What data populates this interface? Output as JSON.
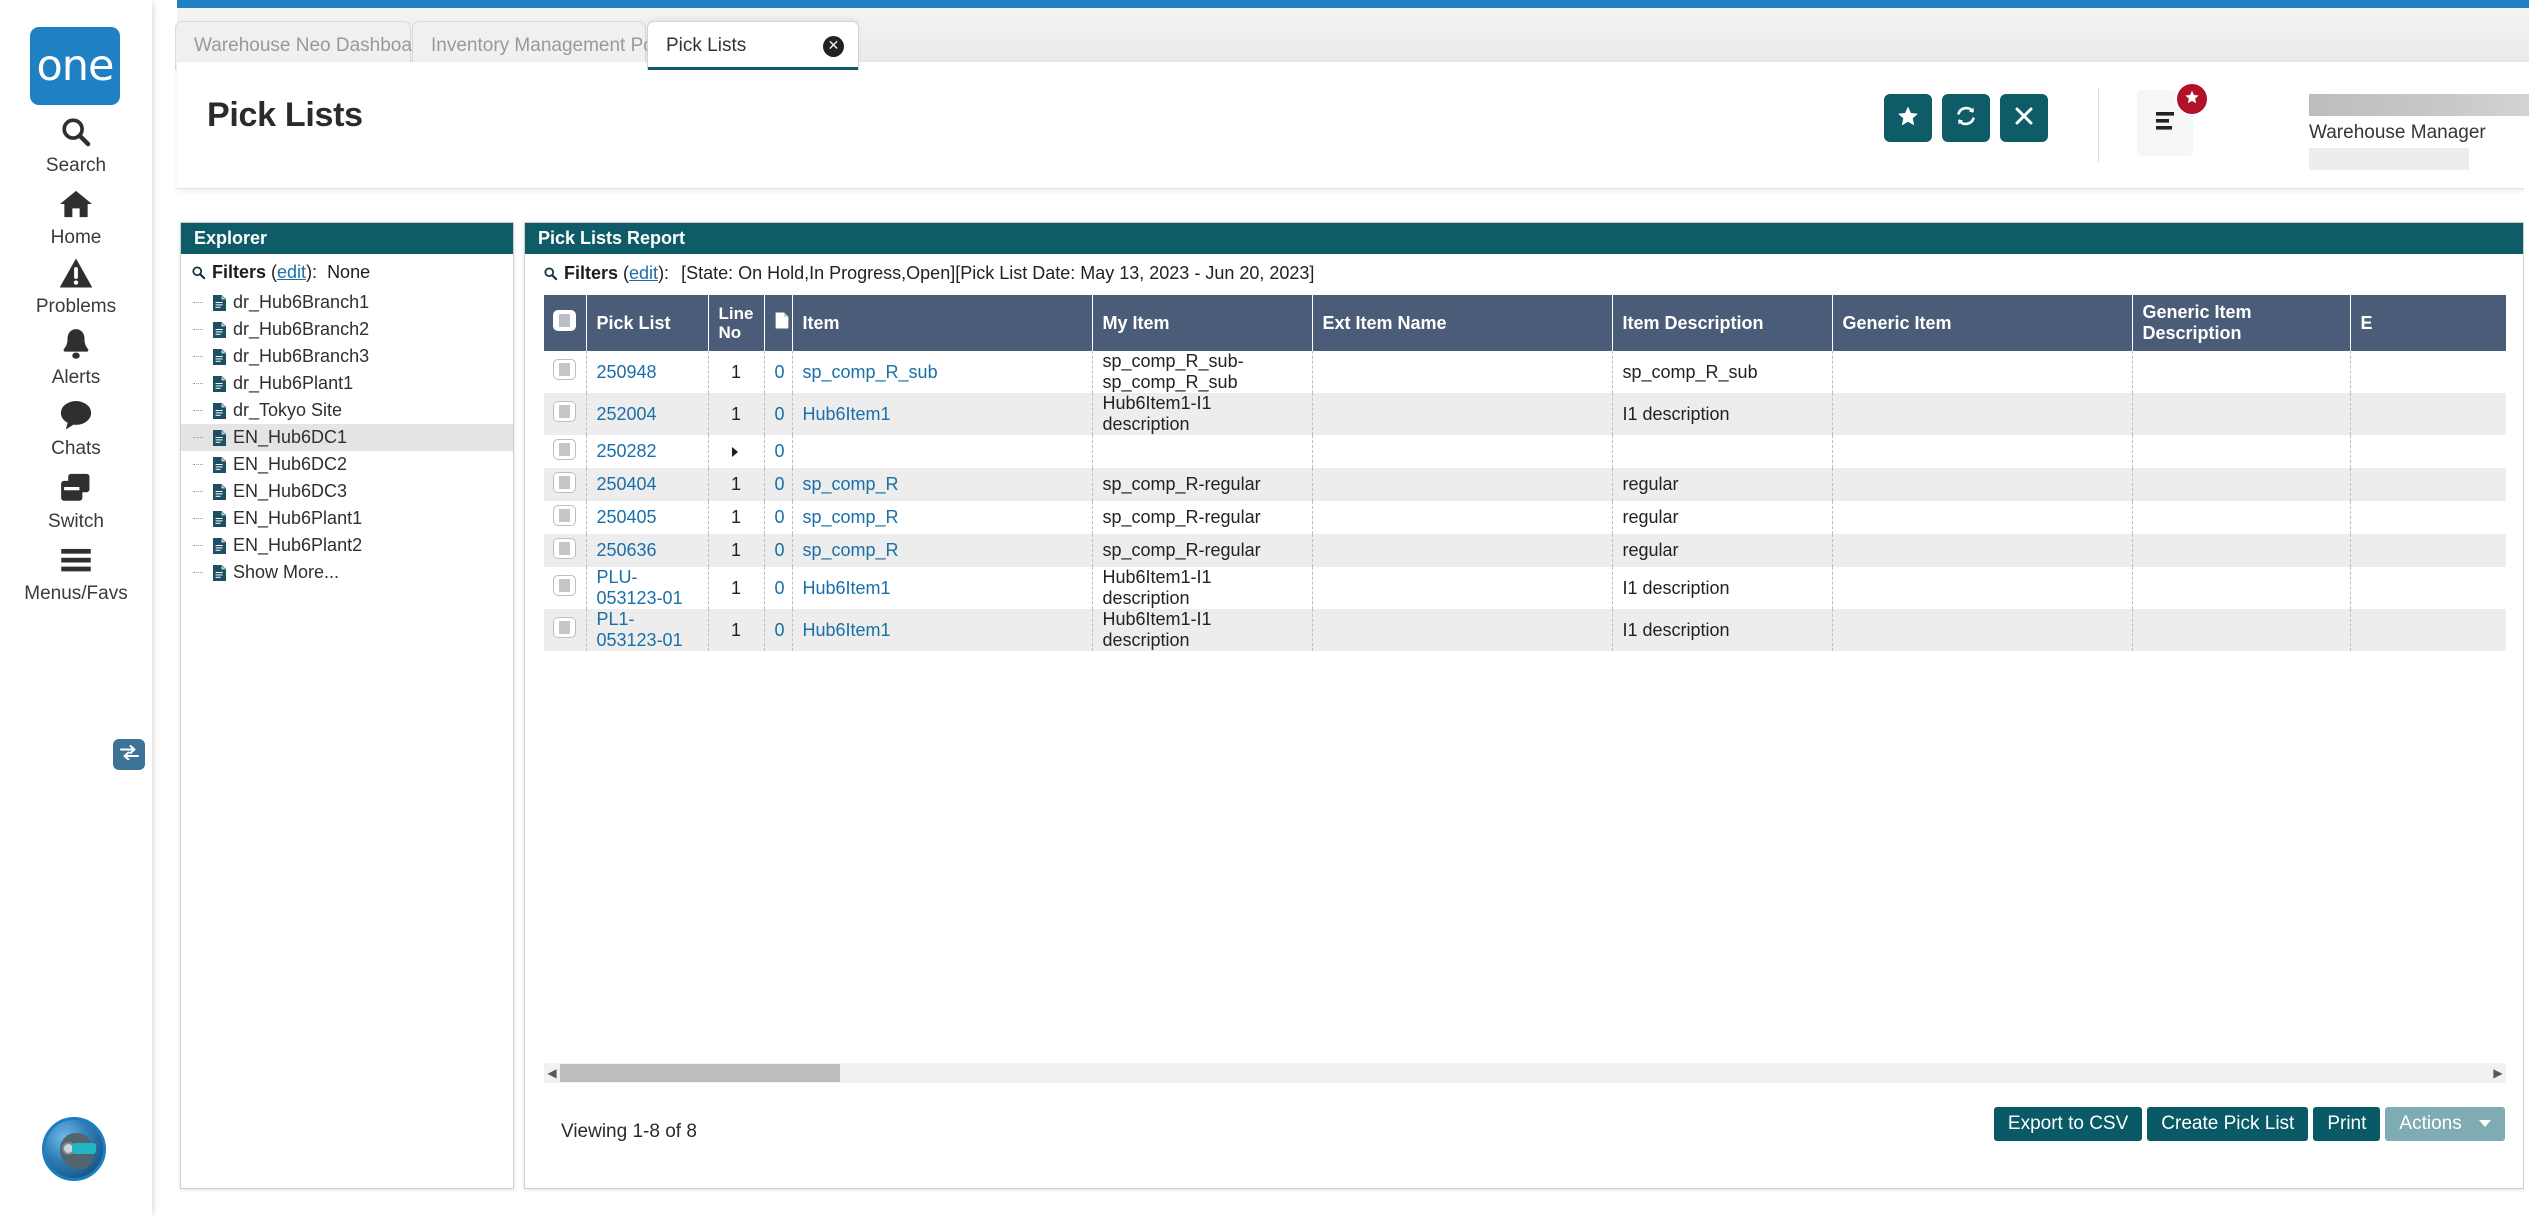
{
  "brand": {
    "logo_text": "one",
    "accent_blue": "#1f80c4",
    "teal": "#0e5c68",
    "header_navy": "#4a5c77"
  },
  "rail": {
    "items": [
      {
        "label": "Search",
        "icon": "search-icon"
      },
      {
        "label": "Home",
        "icon": "home-icon"
      },
      {
        "label": "Problems",
        "icon": "warning-triangle-icon"
      },
      {
        "label": "Alerts",
        "icon": "bell-icon"
      },
      {
        "label": "Chats",
        "icon": "chat-bubble-icon"
      },
      {
        "label": "Switch",
        "icon": "windows-stack-icon"
      },
      {
        "label": "Menus/Favs",
        "icon": "hamburger-icon"
      }
    ]
  },
  "tabs": [
    {
      "label": "Warehouse Neo Dashboard",
      "active": false
    },
    {
      "label": "Inventory Management Policies",
      "active": false
    },
    {
      "label": "Pick Lists",
      "active": true
    }
  ],
  "header": {
    "title": "Pick Lists",
    "buttons": [
      {
        "name": "favorite-button",
        "icon": "star-icon"
      },
      {
        "name": "refresh-button",
        "icon": "refresh-icon"
      },
      {
        "name": "close-button",
        "icon": "x-icon"
      }
    ],
    "menus_favs": {
      "icon": "list-icon",
      "badge_icon": "star-icon"
    },
    "user": {
      "role": "Warehouse Manager",
      "caret": "chevron-down-icon"
    }
  },
  "explorer": {
    "title": "Explorer",
    "filters_label": "Filters",
    "filters_edit": "edit",
    "filters_value": "None",
    "items": [
      {
        "label": "dr_Hub6Branch1",
        "selected": false
      },
      {
        "label": "dr_Hub6Branch2",
        "selected": false
      },
      {
        "label": "dr_Hub6Branch3",
        "selected": false
      },
      {
        "label": "dr_Hub6Plant1",
        "selected": false
      },
      {
        "label": "dr_Tokyo Site",
        "selected": false
      },
      {
        "label": "EN_Hub6DC1",
        "selected": true
      },
      {
        "label": "EN_Hub6DC2",
        "selected": false
      },
      {
        "label": "EN_Hub6DC3",
        "selected": false
      },
      {
        "label": "EN_Hub6Plant1",
        "selected": false
      },
      {
        "label": "EN_Hub6Plant2",
        "selected": false
      },
      {
        "label": "Show More...",
        "selected": false
      }
    ]
  },
  "report": {
    "title": "Pick Lists Report",
    "filters_label": "Filters",
    "filters_edit": "edit",
    "filters_value": "[State: On Hold,In Progress,Open][Pick List Date: May 13, 2023 - Jun 20, 2023]",
    "columns": [
      "",
      "Pick List",
      "Line No",
      "",
      "Item",
      "My Item",
      "Ext Item Name",
      "Item Description",
      "Generic Item",
      "Generic Item Description",
      "E"
    ],
    "rows": [
      {
        "pick_list": "250948",
        "line_no": "1",
        "doc": "0",
        "item": "sp_comp_R_sub",
        "my_item": "sp_comp_R_sub-\nsp_comp_R_sub",
        "ext_item_name": "",
        "item_description": "sp_comp_R_sub",
        "generic_item": "",
        "generic_item_description": ""
      },
      {
        "pick_list": "252004",
        "line_no": "1",
        "doc": "0",
        "item": "Hub6Item1",
        "my_item": "Hub6Item1-I1 description",
        "ext_item_name": "",
        "item_description": "I1 description",
        "generic_item": "",
        "generic_item_description": ""
      },
      {
        "pick_list": "250282",
        "line_no": "",
        "doc": "0",
        "item": "",
        "my_item": "",
        "ext_item_name": "",
        "item_description": "",
        "generic_item": "",
        "generic_item_description": ""
      },
      {
        "pick_list": "250404",
        "line_no": "1",
        "doc": "0",
        "item": "sp_comp_R",
        "my_item": "sp_comp_R-regular",
        "ext_item_name": "",
        "item_description": "regular",
        "generic_item": "",
        "generic_item_description": ""
      },
      {
        "pick_list": "250405",
        "line_no": "1",
        "doc": "0",
        "item": "sp_comp_R",
        "my_item": "sp_comp_R-regular",
        "ext_item_name": "",
        "item_description": "regular",
        "generic_item": "",
        "generic_item_description": ""
      },
      {
        "pick_list": "250636",
        "line_no": "1",
        "doc": "0",
        "item": "sp_comp_R",
        "my_item": "sp_comp_R-regular",
        "ext_item_name": "",
        "item_description": "regular",
        "generic_item": "",
        "generic_item_description": ""
      },
      {
        "pick_list": "PLU-053123-01",
        "line_no": "1",
        "doc": "0",
        "item": "Hub6Item1",
        "my_item": "Hub6Item1-I1 description",
        "ext_item_name": "",
        "item_description": "I1 description",
        "generic_item": "",
        "generic_item_description": ""
      },
      {
        "pick_list": "PL1-053123-01",
        "line_no": "1",
        "doc": "0",
        "item": "Hub6Item1",
        "my_item": "Hub6Item1-I1 description",
        "ext_item_name": "",
        "item_description": "I1 description",
        "generic_item": "",
        "generic_item_description": ""
      }
    ],
    "viewing": "Viewing 1-8 of 8",
    "footer_buttons": [
      {
        "label": "Export to CSV",
        "muted": false
      },
      {
        "label": "Create Pick List",
        "muted": false
      },
      {
        "label": "Print",
        "muted": false
      },
      {
        "label": "Actions",
        "muted": true,
        "caret": true
      }
    ]
  }
}
